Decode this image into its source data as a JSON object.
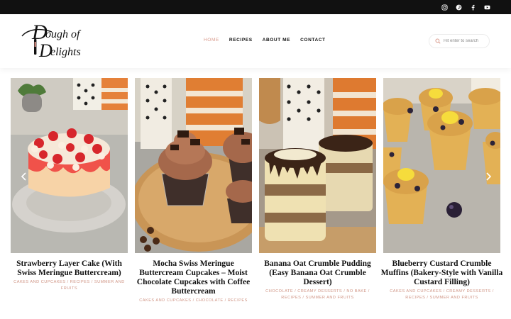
{
  "header": {
    "logo_text": "Dough of Delights",
    "nav": [
      {
        "label": "HOME",
        "active": true
      },
      {
        "label": "RECIPES",
        "active": false
      },
      {
        "label": "ABOUT ME",
        "active": false
      },
      {
        "label": "CONTACT",
        "active": false
      }
    ],
    "search_placeholder": "Hit enter to search"
  },
  "topbar": {
    "social_icons": [
      "instagram-icon",
      "pinterest-icon",
      "facebook-icon",
      "youtube-icon"
    ]
  },
  "carousel": {
    "cards": [
      {
        "title": "Strawberry Layer Cake (With Swiss Meringue Buttercream)",
        "categories": "CAKES AND CUPCAKES / RECIPES / SUMMER AND FRUITS"
      },
      {
        "title": "Mocha Swiss Meringue Buttercream Cupcakes – Moist Chocolate Cupcakes with Coffee Buttercream",
        "categories": "CAKES AND CUPCAKES / CHOCOLATE / RECIPES"
      },
      {
        "title": "Banana Oat Crumble Pudding (Easy Banana Oat Crumble Dessert)",
        "categories": "CHOCOLATE / CREAMY DESSERTS / NO BAKE / RECIPES / SUMMER AND FRUITS"
      },
      {
        "title": "Blueberry Custard Crumble Muffins (Bakery-Style with Vanilla Custard Filling)",
        "categories": "CAKES AND CUPCAKES / CREAMY DESSERTS / RECIPES / SUMMER AND FRUITS"
      }
    ]
  },
  "colors": {
    "accent": "#d99a8c",
    "topbar": "#111111"
  }
}
